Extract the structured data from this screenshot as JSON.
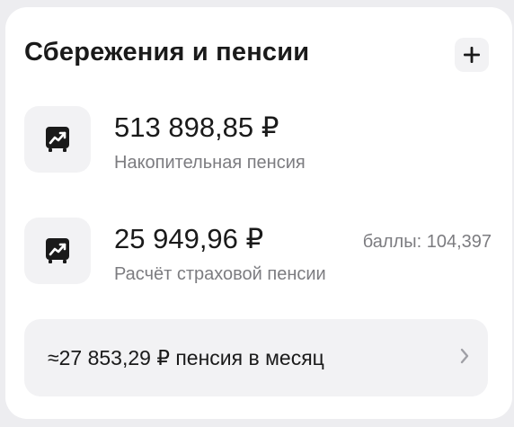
{
  "section": {
    "title": "Сбережения и пенсии",
    "add_icon": "plus-icon"
  },
  "accounts": [
    {
      "icon": "safe-chart-icon",
      "amount": "513 898,85 ₽",
      "label": "Накопительная пенсия"
    },
    {
      "icon": "safe-chart-icon",
      "amount": "25 949,96 ₽",
      "label": "Расчёт страховой пенсии",
      "points": "баллы: 104,397"
    }
  ],
  "monthly": {
    "text": "≈27 853,29 ₽ пенсия в месяц",
    "icon": "chevron-right-icon"
  },
  "colors": {
    "background": "#ededf0",
    "card": "#ffffff",
    "tile": "#f2f2f4",
    "text_primary": "#1a1a1a",
    "text_secondary": "#7c7c80"
  }
}
